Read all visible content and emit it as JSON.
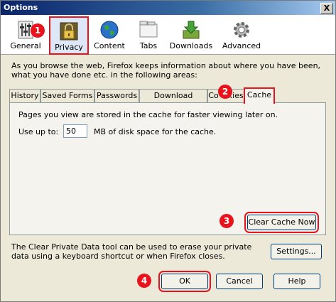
{
  "window": {
    "title": "Options",
    "close_glyph": "X"
  },
  "toolbar": {
    "panes": [
      {
        "label": "General",
        "icon": "general-icon"
      },
      {
        "label": "Privacy",
        "icon": "privacy-lock-icon"
      },
      {
        "label": "Content",
        "icon": "content-globe-icon"
      },
      {
        "label": "Tabs",
        "icon": "tabs-icon"
      },
      {
        "label": "Downloads",
        "icon": "downloads-icon"
      },
      {
        "label": "Advanced",
        "icon": "advanced-gear-icon"
      }
    ],
    "selected": "Privacy"
  },
  "privacy": {
    "description": "As you browse the web, Firefox keeps information about where you have been, what you have done etc. in the following areas:",
    "tabs": [
      "History",
      "Saved Forms",
      "Passwords",
      "Download History",
      "Co",
      "kies",
      "Cache"
    ],
    "active_tab": "Cache",
    "cache": {
      "description": "Pages you view are stored in the cache for faster viewing later on.",
      "use_up_to_label": "Use up to:",
      "size_value": "50",
      "size_suffix": "MB of disk space for the cache.",
      "clear_button": "Clear Cache Now"
    },
    "clear_data_text": "The Clear Private Data tool can be used to erase your private data using a keyboard shortcut or when Firefox closes.",
    "settings_button": "Settings..."
  },
  "buttons": {
    "ok": "OK",
    "cancel": "Cancel",
    "help": "Help"
  },
  "annotations": {
    "step1": "1",
    "step2": "2",
    "step3": "3",
    "step4": "4"
  },
  "colors": {
    "annotation_red": "#e8131d",
    "title_bar": "#0a246a"
  }
}
